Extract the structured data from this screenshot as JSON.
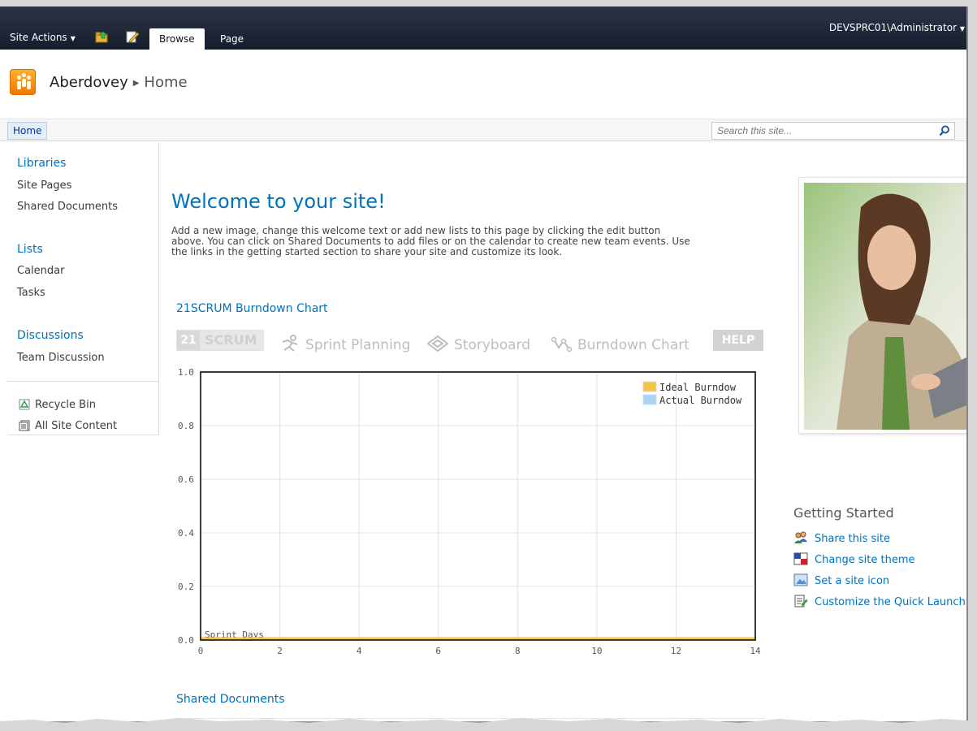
{
  "ribbon": {
    "site_actions": "Site Actions",
    "tabs": [
      {
        "label": "Browse",
        "active": true
      },
      {
        "label": "Page",
        "active": false
      }
    ],
    "user": "DEVSPRC01\\Administrator"
  },
  "title": {
    "site_name": "Aberdovey",
    "current_page": "Home"
  },
  "topnav": {
    "home_tab": "Home",
    "search_placeholder": "Search this site..."
  },
  "quicklaunch": {
    "libraries": "Libraries",
    "site_pages": "Site Pages",
    "shared_documents": "Shared Documents",
    "lists": "Lists",
    "calendar": "Calendar",
    "tasks": "Tasks",
    "discussions": "Discussions",
    "team_discussion": "Team Discussion",
    "recycle_bin": "Recycle Bin",
    "all_site_content": "All Site Content"
  },
  "main": {
    "welcome": "Welcome to your site!",
    "intro_lines": [
      "Add a new image, change this welcome text or add new lists to this page by clicking the edit button",
      "above. You can click on Shared Documents to add files or on the calendar to create new team events. Use",
      "the links in the getting started section to share your site and customize its look."
    ],
    "burndown_title": "21SCRUM Burndown Chart",
    "scrum": {
      "logo_num": "21",
      "logo_text": "SCRUM",
      "sprint_planning": "Sprint Planning",
      "storyboard": "Storyboard",
      "burndown_chart": "Burndown Chart",
      "help": "HELP"
    },
    "shared_documents_title": "Shared Documents"
  },
  "getting_started": {
    "title": "Getting Started",
    "links": [
      "Share this site",
      "Change site theme",
      "Set a site icon",
      "Customize the Quick Launch"
    ]
  },
  "colors": {
    "accent": "#0072bc",
    "ideal": "#f5c242",
    "actual": "#a9d4f5"
  },
  "chart_data": {
    "type": "line",
    "xlabel": "Sprint Days",
    "x_ticks": [
      0,
      2,
      4,
      6,
      8,
      10,
      12,
      14
    ],
    "y_ticks": [
      0.0,
      0.2,
      0.4,
      0.6,
      0.8,
      1.0
    ],
    "xlim": [
      0,
      14
    ],
    "ylim": [
      0,
      1.0
    ],
    "grid": true,
    "legend_position": "top-right",
    "series": [
      {
        "name": "Ideal Burndow",
        "color": "#f5c242",
        "x": [
          0,
          14
        ],
        "y": [
          0,
          0
        ]
      },
      {
        "name": "Actual Burndow",
        "color": "#a9d4f5",
        "x": [],
        "y": []
      }
    ]
  }
}
